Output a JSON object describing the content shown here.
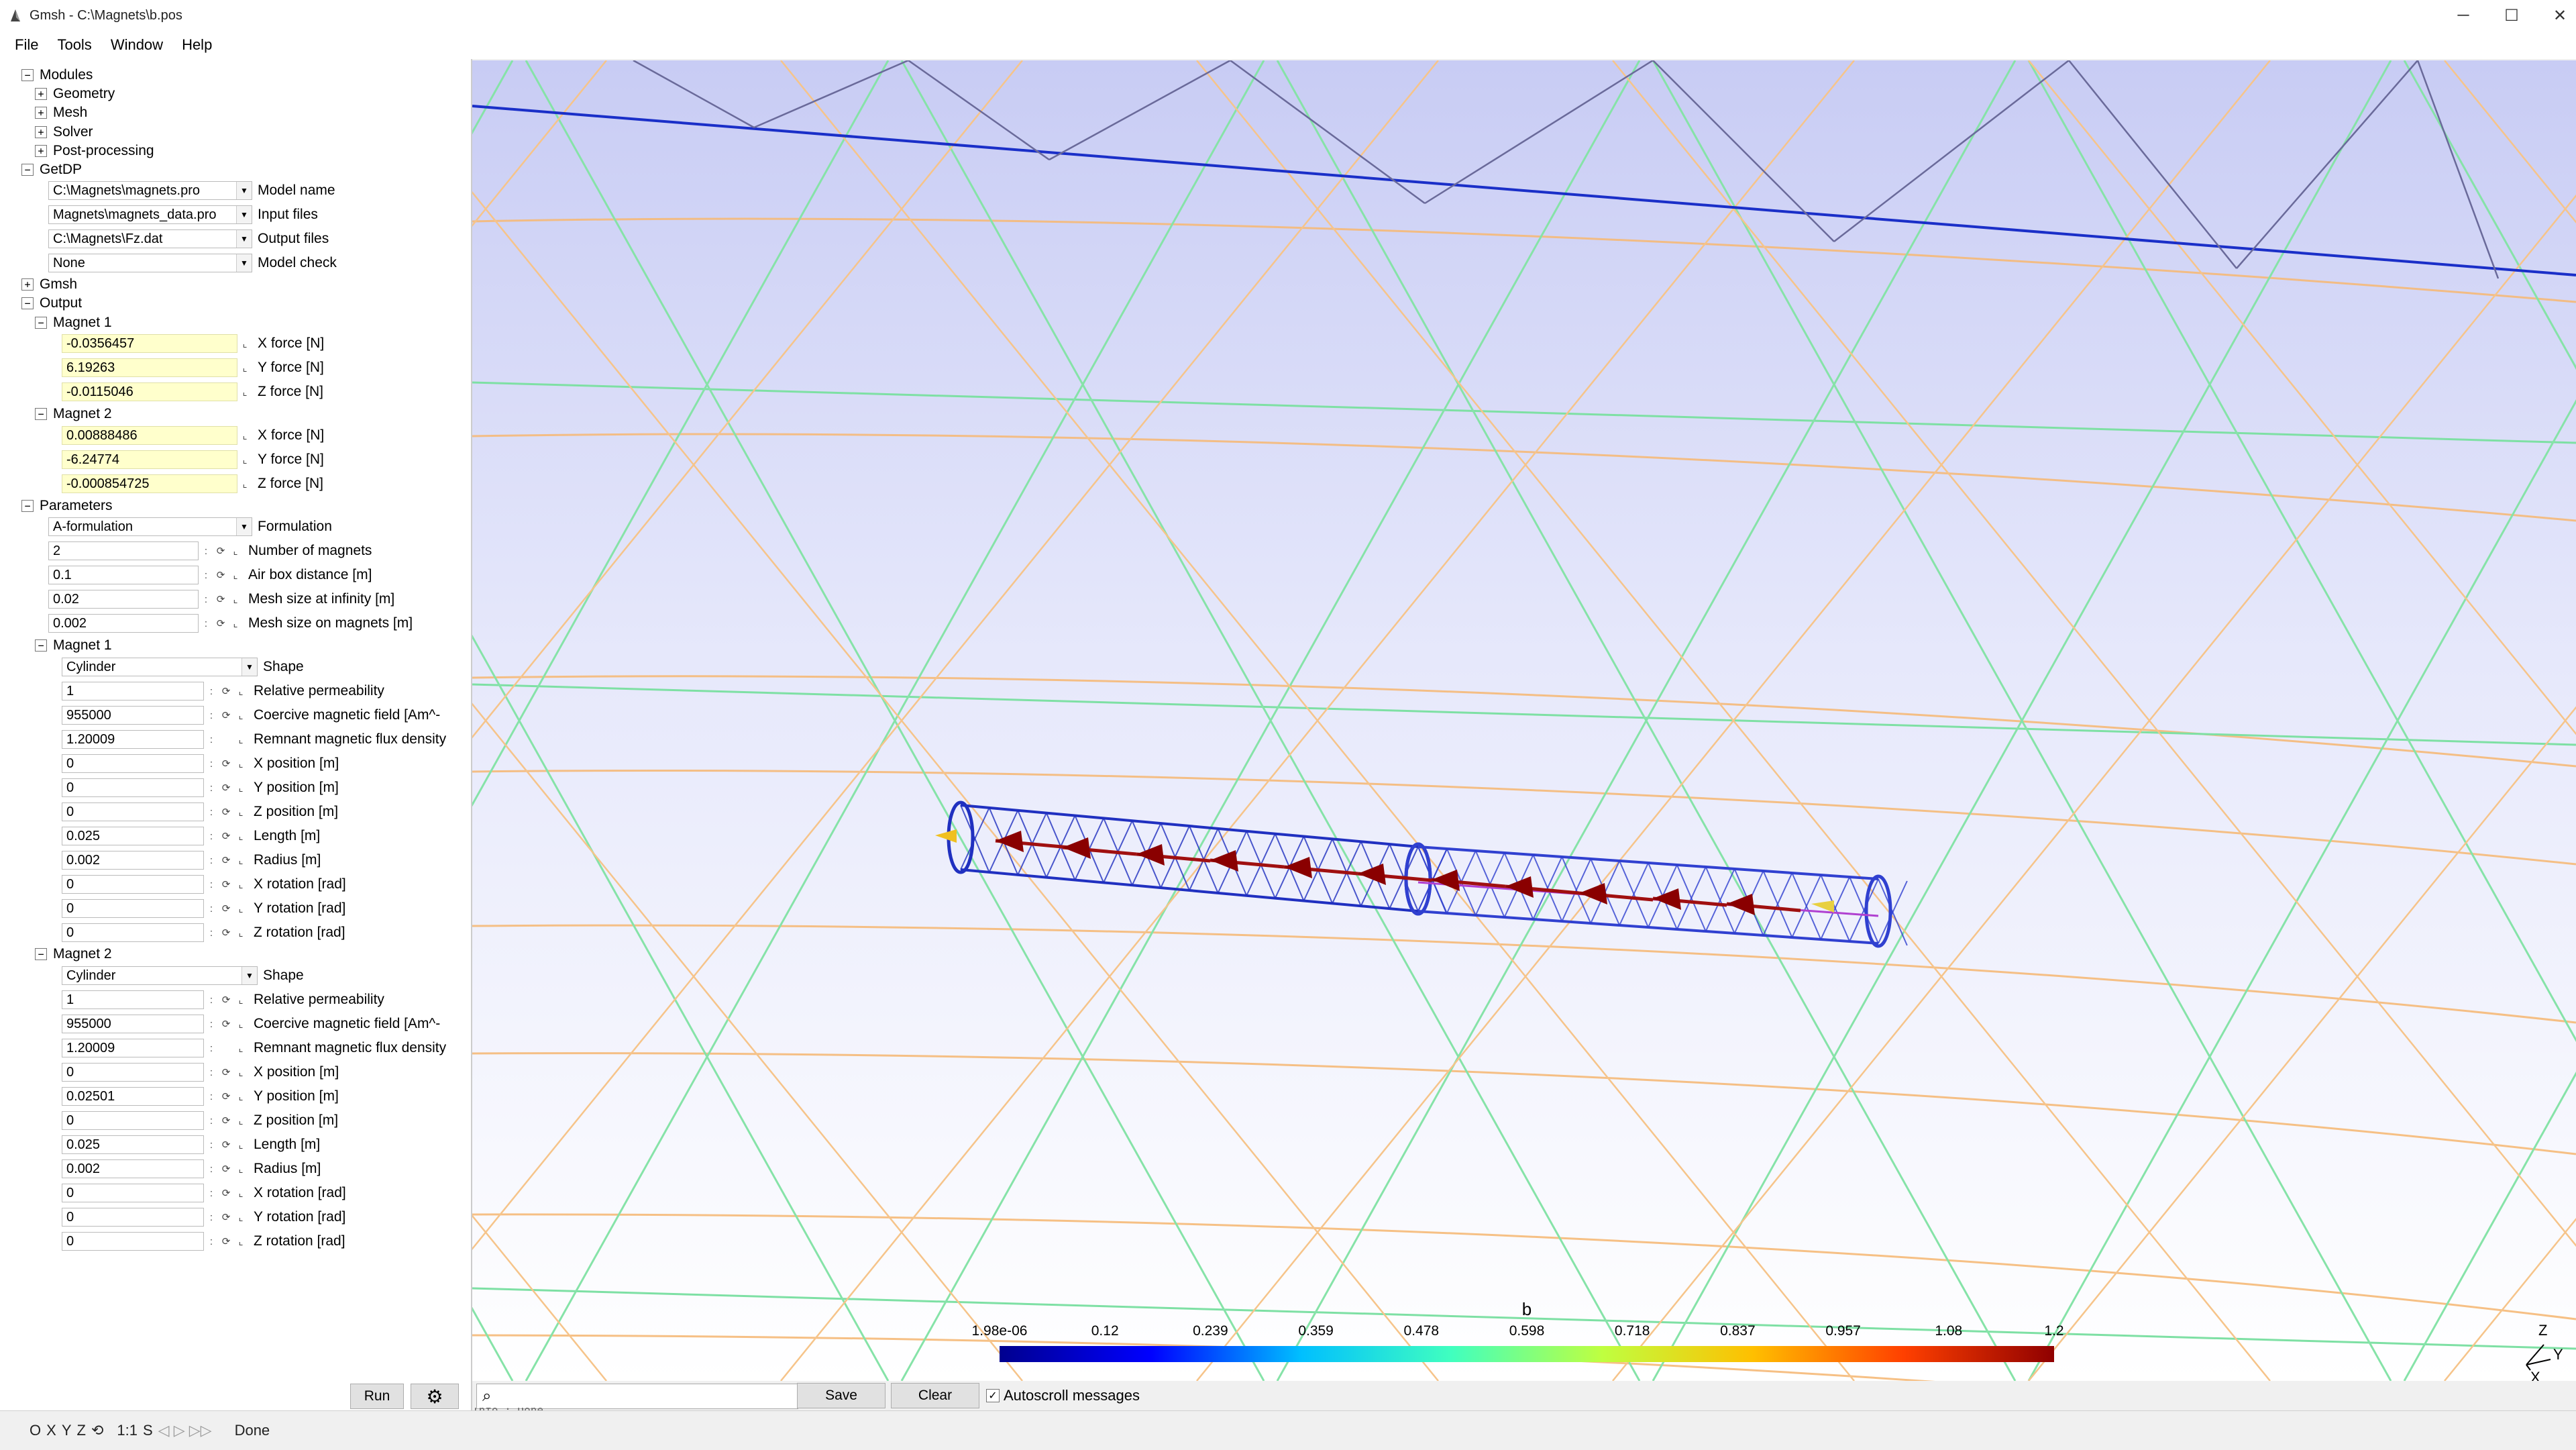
{
  "window": {
    "title": "Gmsh - C:\\Magnets\\b.pos",
    "minimize": "─",
    "maximize": "☐",
    "close": "✕"
  },
  "menu": [
    {
      "label": "File"
    },
    {
      "label": "Tools"
    },
    {
      "label": "Window"
    },
    {
      "label": "Help"
    }
  ],
  "tree": {
    "modules": "Modules",
    "geometry": "Geometry",
    "mesh": "Mesh",
    "solver": "Solver",
    "postprocessing": "Post-processing",
    "getdp": "GetDP",
    "gmsh": "Gmsh",
    "output": "Output",
    "parameters": "Parameters",
    "expand": "+",
    "collapse": "−"
  },
  "getdp": {
    "model_name": {
      "value": "C:\\Magnets\\magnets.pro",
      "label": "Model name"
    },
    "input_files": {
      "value": "Magnets\\magnets_data.pro",
      "label": "Input files"
    },
    "output_files": {
      "value": "C:\\Magnets\\Fz.dat",
      "label": "Output files"
    },
    "model_check": {
      "value": "None",
      "label": "Model check"
    }
  },
  "output": {
    "magnet1": {
      "title": "Magnet 1",
      "x": "-0.0356457",
      "y": "6.19263",
      "z": "-0.0115046"
    },
    "magnet2": {
      "title": "Magnet 2",
      "x": "0.00888486",
      "y": "-6.24774",
      "z": "-0.000854725"
    },
    "x_label": "X force [N]",
    "y_label": "Y force [N]",
    "z_label": "Z force [N]"
  },
  "parameters": {
    "formulation": {
      "value": "A-formulation",
      "label": "Formulation"
    },
    "num_magnets": {
      "value": "2",
      "label": "Number of magnets"
    },
    "air_box": {
      "value": "0.1",
      "label": "Air box distance [m]"
    },
    "mesh_inf": {
      "value": "0.02",
      "label": "Mesh size at infinity [m]"
    },
    "mesh_mag": {
      "value": "0.002",
      "label": "Mesh size on magnets [m]"
    }
  },
  "magnets": {
    "shape_label": "Shape",
    "perm_label": "Relative permeability",
    "coercive_label": "Coercive magnetic field [Am^-",
    "remnant_label": "Remnant magnetic flux density",
    "xpos_label": "X position [m]",
    "ypos_label": "Y position [m]",
    "zpos_label": "Z position [m]",
    "length_label": "Length [m]",
    "radius_label": "Radius [m]",
    "xrot_label": "X rotation [rad]",
    "yrot_label": "Y rotation [rad]",
    "zrot_label": "Z rotation [rad]",
    "m1": {
      "title": "Magnet 1",
      "shape": "Cylinder",
      "perm": "1",
      "coercive": "955000",
      "remnant": "1.20009",
      "xpos": "0",
      "ypos": "0",
      "zpos": "0",
      "length": "0.025",
      "radius": "0.002",
      "xrot": "0",
      "yrot": "0",
      "zrot": "0"
    },
    "m2": {
      "title": "Magnet 2",
      "shape": "Cylinder",
      "perm": "1",
      "coercive": "955000",
      "remnant": "1.20009",
      "xpos": "0",
      "ypos": "0.02501",
      "zpos": "0",
      "length": "0.025",
      "radius": "0.002",
      "xrot": "0",
      "yrot": "0",
      "zrot": "0"
    }
  },
  "icons": {
    "spin": "⟳",
    "graph": "⌞",
    "range": ":",
    "dropdown": "▼",
    "search": "⌕",
    "gear": "⚙"
  },
  "buttons": {
    "run": "Run",
    "save": "Save",
    "clear": "Clear",
    "autoscroll": "Autoscroll messages"
  },
  "colorbar": {
    "title": "b",
    "ticks": [
      "1.98e-06",
      "0.12",
      "0.239",
      "0.359",
      "0.478",
      "0.598",
      "0.718",
      "0.837",
      "0.957",
      "1.08",
      "1.2"
    ],
    "colors": [
      "#00008f",
      "#0000ff",
      "#00bfff",
      "#40ffbf",
      "#bfff40",
      "#ffbf00",
      "#ff4000",
      "#8f0000"
    ]
  },
  "axes": {
    "x": "X",
    "y": "Y",
    "z": "Z"
  },
  "log": {
    "line1": "Info    : Done"
  },
  "status": {
    "o": "O",
    "x": "X",
    "y": "Y",
    "z": "Z",
    "rot": "⟲",
    "scale": "1:1",
    "s": "S",
    "nav": "◁ ▷ ▷▷",
    "text": "Done"
  }
}
